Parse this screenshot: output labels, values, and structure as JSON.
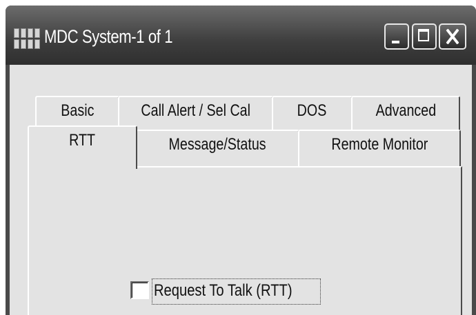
{
  "window": {
    "title": "MDC System-1 of 1"
  },
  "tabs": {
    "row1": [
      {
        "label": "Basic"
      },
      {
        "label": "Call Alert / Sel Cal"
      },
      {
        "label": "DOS"
      },
      {
        "label": "Advanced"
      }
    ],
    "row2": [
      {
        "label": "RTT",
        "selected": true
      },
      {
        "label": "Message/Status"
      },
      {
        "label": "Remote Monitor"
      }
    ]
  },
  "panel": {
    "rtt_checkbox": {
      "label": "Request To Talk (RTT)",
      "checked": false
    }
  }
}
